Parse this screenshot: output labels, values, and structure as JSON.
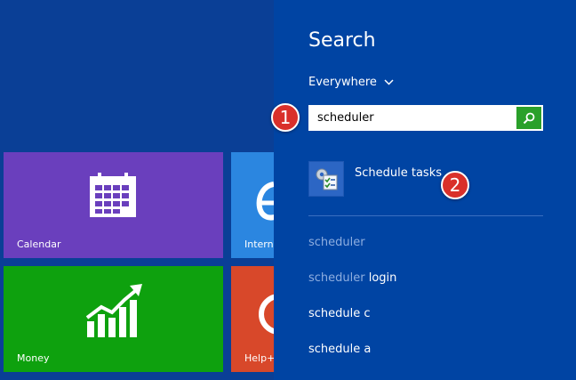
{
  "start_screen": {
    "tiles": [
      {
        "name": "calendar",
        "label": "Calendar",
        "icon": "calendar-icon",
        "color": "#6a3fbd"
      },
      {
        "name": "internet-explorer",
        "label": "Intern",
        "icon": "internet-explorer-icon",
        "color": "#2b86e0"
      },
      {
        "name": "money",
        "label": "Money",
        "icon": "chart-up-icon",
        "color": "#0ea10e"
      },
      {
        "name": "help-tips",
        "label": "Help+",
        "icon": "help-icon",
        "color": "#d8482a"
      }
    ]
  },
  "search_charm": {
    "title": "Search",
    "scope": "Everywhere",
    "query": "scheduler",
    "search_button_icon": "search-icon",
    "result": {
      "label": "Schedule tasks",
      "icon": "task-scheduler-icon"
    },
    "suggestions": [
      {
        "bold": "",
        "dim": "scheduler",
        "tail": ""
      },
      {
        "bold": "",
        "dim": "scheduler",
        "tail": " login"
      },
      {
        "bold": "schedule c",
        "dim": "",
        "tail": ""
      },
      {
        "bold": "schedule a",
        "dim": "",
        "tail": ""
      }
    ]
  },
  "annotations": {
    "step1": "1",
    "step2": "2"
  },
  "colors": {
    "charm_bg": "#0044a3",
    "start_bg": "#0a3f96",
    "badge": "#d9302a",
    "search_btn": "#2aa02a"
  }
}
